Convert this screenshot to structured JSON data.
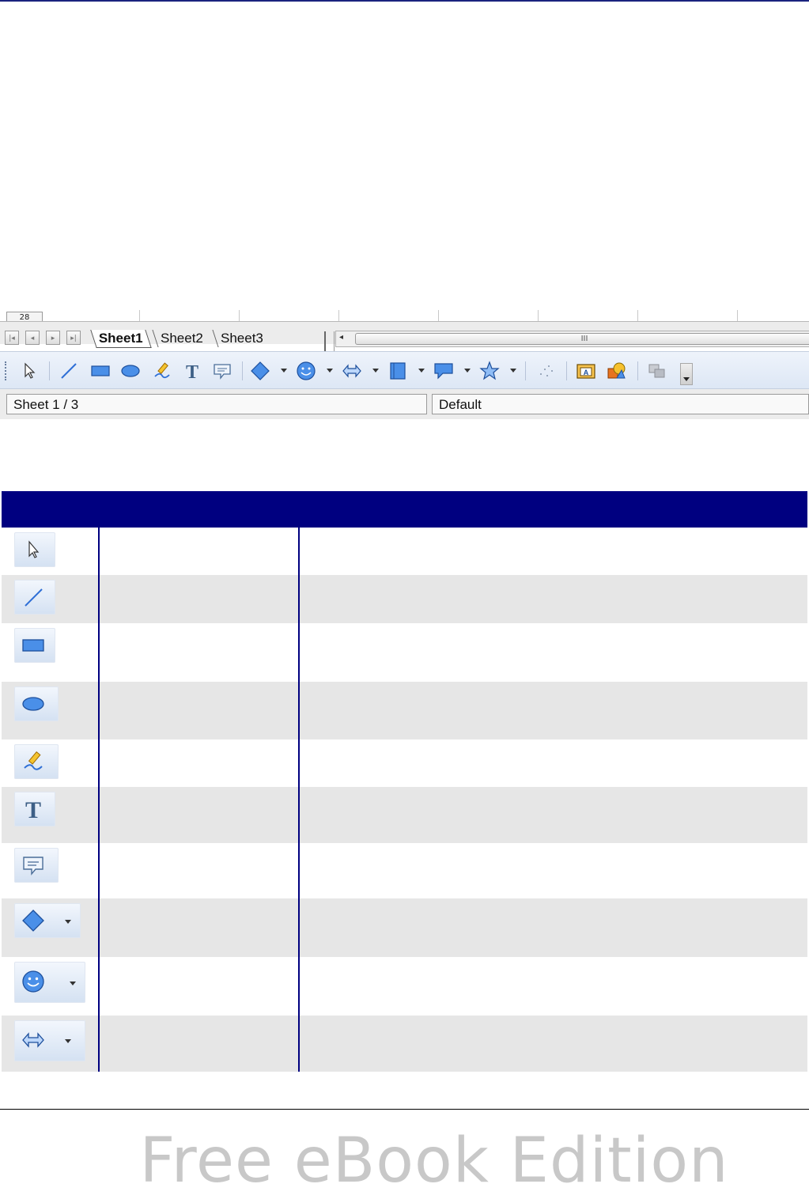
{
  "screenshot": {
    "row_number": "28",
    "sheet_nav_icons": [
      "first-sheet-icon",
      "prev-sheet-icon",
      "next-sheet-icon",
      "last-sheet-icon"
    ],
    "sheet_tabs": [
      {
        "label": "Sheet1",
        "active": true
      },
      {
        "label": "Sheet2",
        "active": false
      },
      {
        "label": "Sheet3",
        "active": false
      }
    ],
    "hscroll_grip": "III",
    "drawing_toolbar": [
      "select-icon",
      "line-icon",
      "rectangle-icon",
      "ellipse-icon",
      "freeform-icon",
      "text-icon",
      "callout-icon",
      "basic-shapes-icon",
      "symbol-shapes-icon",
      "block-arrows-icon",
      "flowchart-icon",
      "callouts-icon",
      "stars-icon",
      "points-icon",
      "fontwork-icon",
      "extrusion-icon",
      "toggle-extrusion-icon"
    ],
    "status": {
      "sheet_indicator": "Sheet 1 / 3",
      "page_style": "Default"
    }
  },
  "table": {
    "rows": [
      {
        "icon": "select-icon",
        "label": "",
        "description": ""
      },
      {
        "icon": "line-icon",
        "label": "",
        "description": ""
      },
      {
        "icon": "rectangle-icon",
        "label": "",
        "description": ""
      },
      {
        "icon": "ellipse-icon",
        "label": "",
        "description": ""
      },
      {
        "icon": "freeform-line-icon",
        "label": "",
        "description": ""
      },
      {
        "icon": "text-icon",
        "label": "",
        "description": ""
      },
      {
        "icon": "callout-icon",
        "label": "",
        "description": ""
      },
      {
        "icon": "basic-shapes-icon",
        "label": "",
        "description": ""
      },
      {
        "icon": "symbol-shapes-icon",
        "label": "",
        "description": ""
      },
      {
        "icon": "block-arrows-icon",
        "label": "",
        "description": ""
      }
    ]
  },
  "footer": {
    "text": "Free eBook Edition"
  },
  "colors": {
    "header_navy": "#000080",
    "icon_blue": "#2f6fd6",
    "row_alt": "#e6e6e6"
  }
}
